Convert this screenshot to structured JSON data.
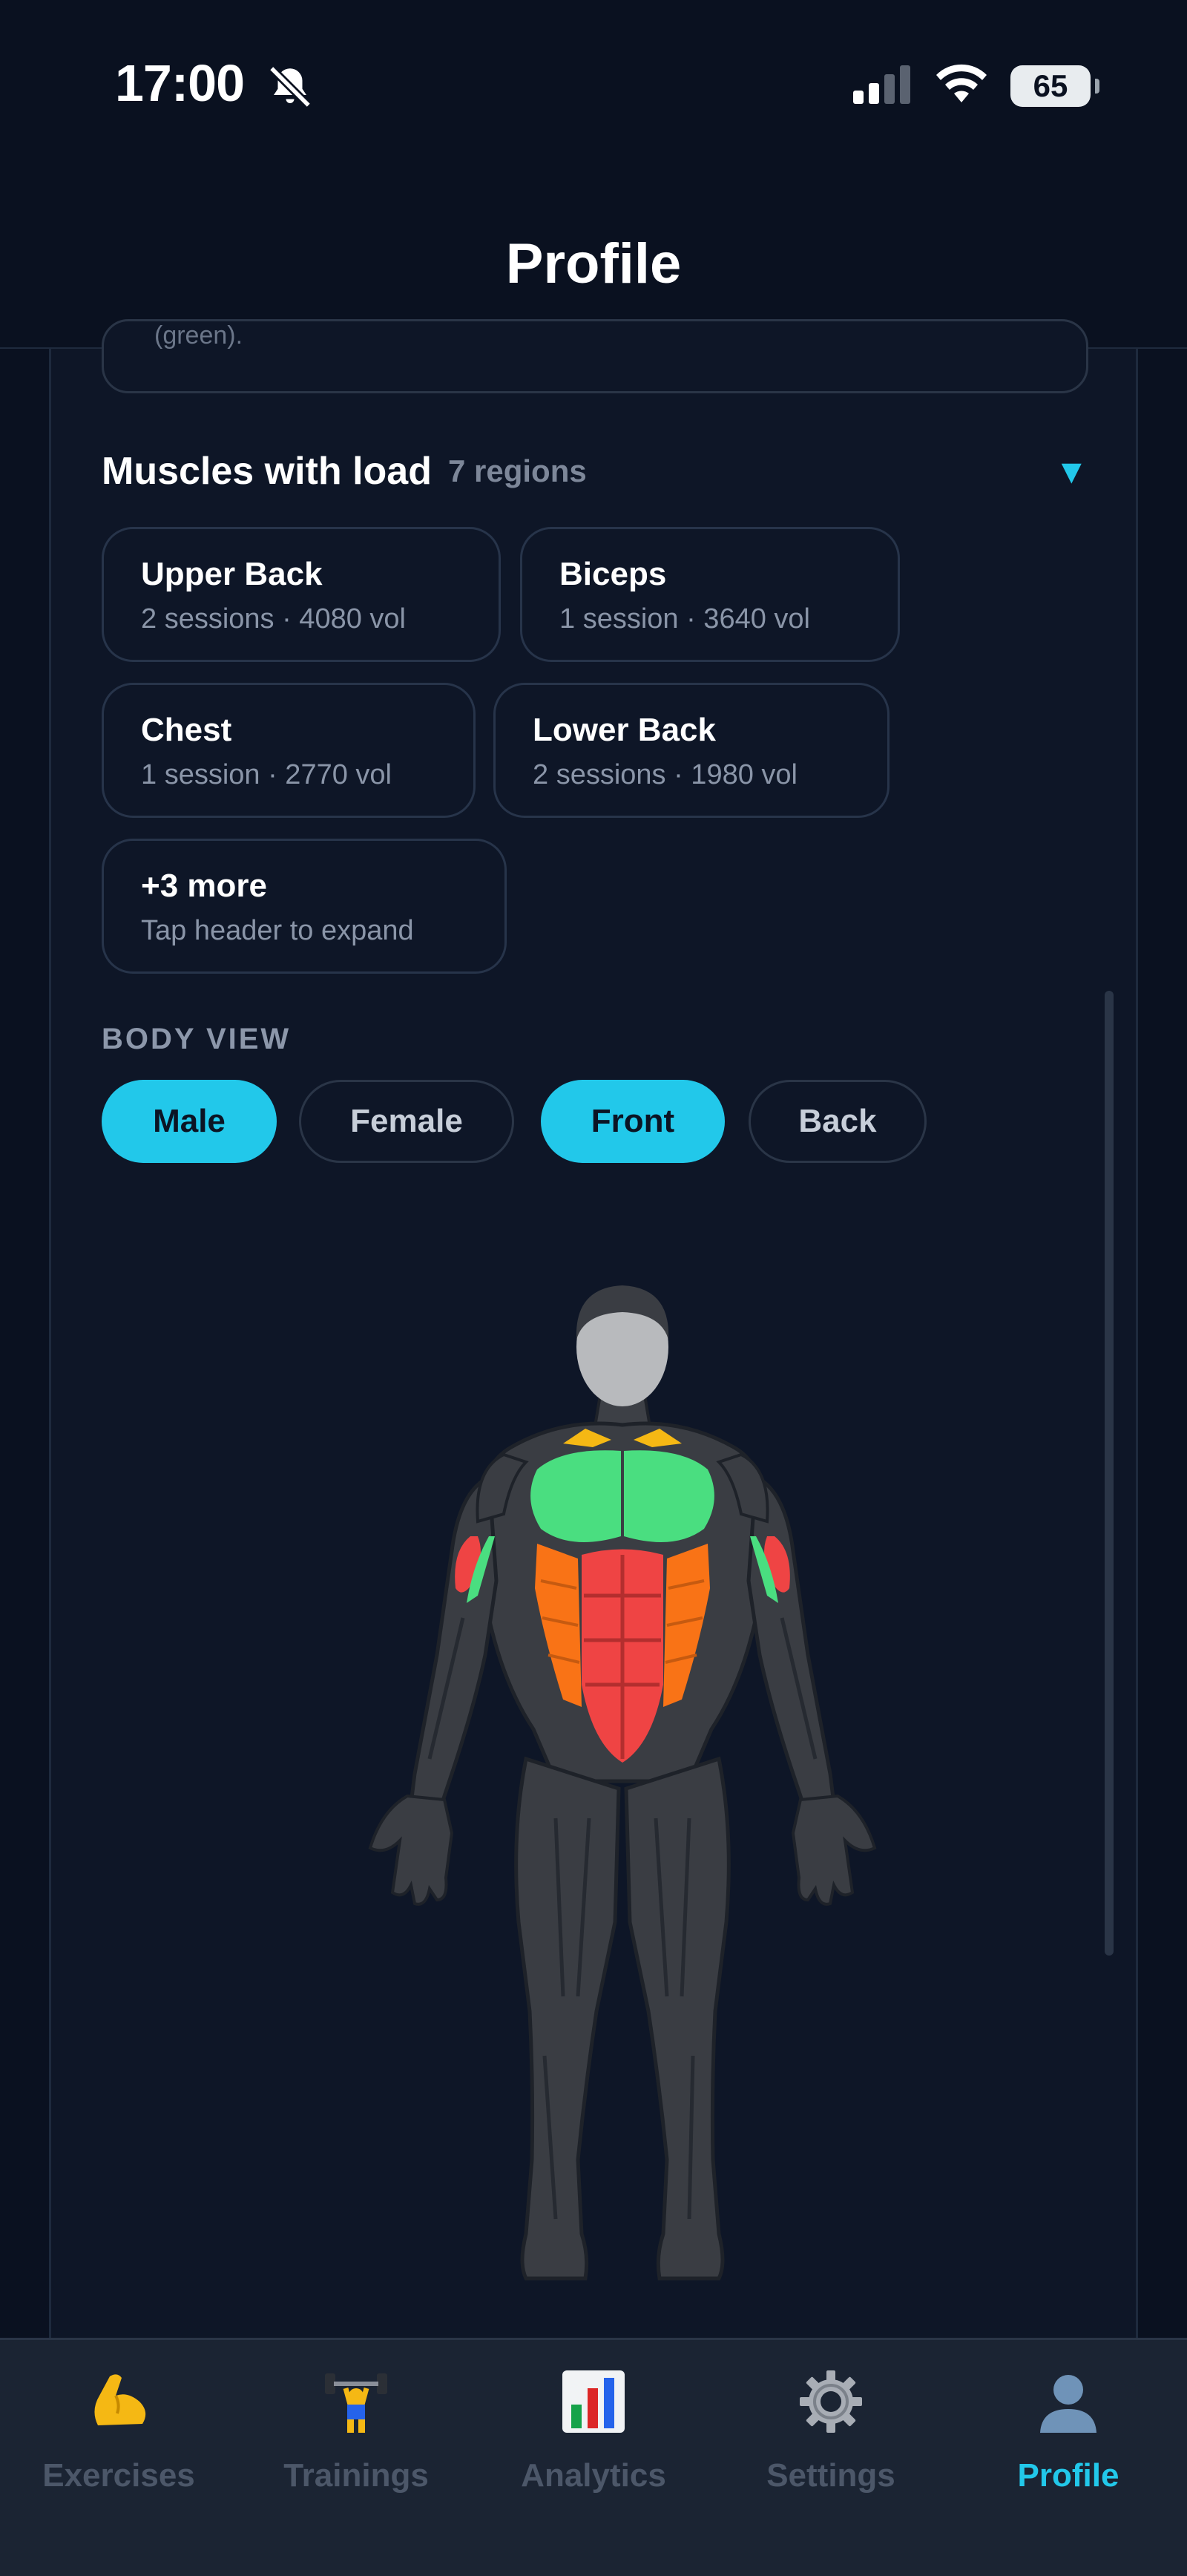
{
  "status_bar": {
    "time": "17:00",
    "battery": "65",
    "icons": [
      "bell-slash-icon",
      "cellular-signal-icon",
      "wifi-icon",
      "battery-icon"
    ]
  },
  "header": {
    "title": "Profile"
  },
  "previous_card": {
    "text": "(green)."
  },
  "muscles": {
    "title": "Muscles with load",
    "count": "7 regions",
    "caret": "▼",
    "items": [
      {
        "name": "Upper Back",
        "detail": "2 sessions · 4080 vol"
      },
      {
        "name": "Biceps",
        "detail": "1 session · 3640 vol"
      },
      {
        "name": "Chest",
        "detail": "1 session · 2770 vol"
      },
      {
        "name": "Lower Back",
        "detail": "2 sessions · 1980 vol"
      },
      {
        "name": "+3 more",
        "detail": "Tap header to expand"
      }
    ]
  },
  "body_view": {
    "label": "BODY VIEW",
    "options": [
      {
        "label": "Male",
        "selected": true
      },
      {
        "label": "Female",
        "selected": false
      },
      {
        "label": "Front",
        "selected": true
      },
      {
        "label": "Back",
        "selected": false
      }
    ],
    "load_colors": {
      "high": "#ef4444",
      "medium": "#f97316",
      "low": "#4ade80",
      "light": "#f5b814",
      "none": "#3a3d43"
    }
  },
  "tab_bar": {
    "tabs": [
      {
        "label": "Exercises",
        "icon": "flexed-biceps-icon",
        "active": false
      },
      {
        "label": "Trainings",
        "icon": "weightlifter-icon",
        "active": false
      },
      {
        "label": "Analytics",
        "icon": "bar-chart-icon",
        "active": false
      },
      {
        "label": "Settings",
        "icon": "gear-icon",
        "active": false
      },
      {
        "label": "Profile",
        "icon": "user-silhouette-icon",
        "active": true
      }
    ],
    "accent": "#22c8ea"
  }
}
